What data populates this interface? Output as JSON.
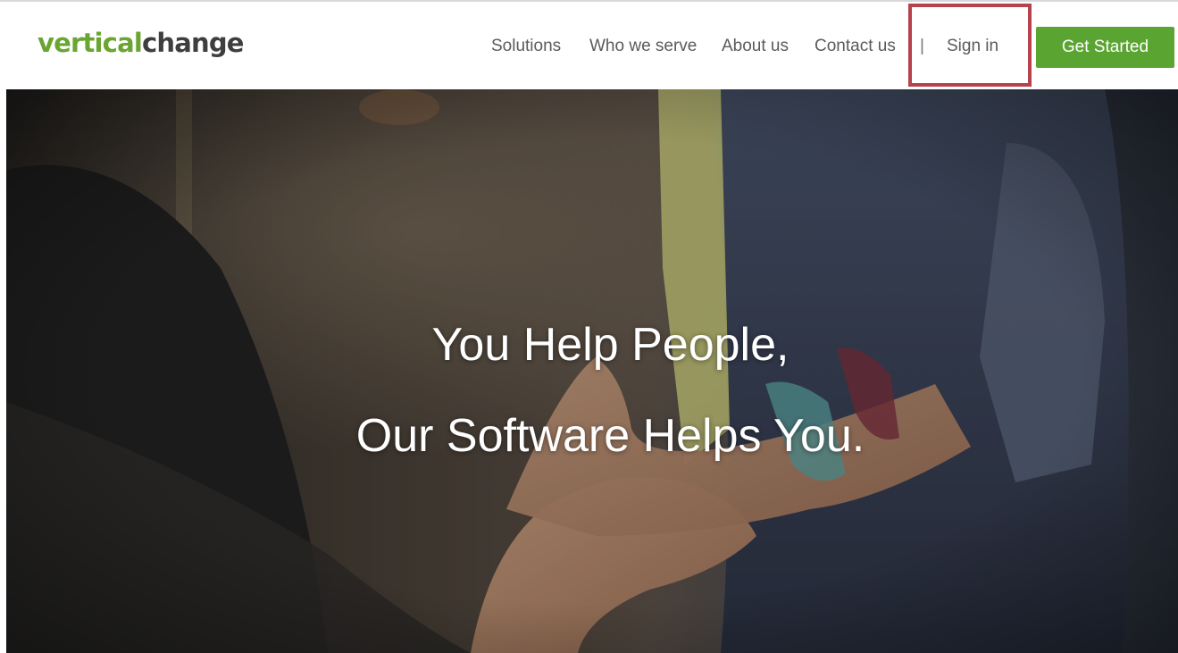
{
  "header": {
    "logo": {
      "part1": "vertical",
      "part2": "change"
    },
    "nav": [
      {
        "label": "Solutions"
      },
      {
        "label": "Who we serve"
      },
      {
        "label": "About us"
      },
      {
        "label": "Contact us"
      }
    ],
    "separator": "|",
    "sign_in_label": "Sign in",
    "cta_label": "Get Started"
  },
  "hero": {
    "line1": "You Help People,",
    "line2": "Our Software Helps You."
  },
  "colors": {
    "brand_green": "#6aa431",
    "cta_green": "#5aa532",
    "highlight_red": "#b5424c",
    "nav_text": "#5b5b5b"
  }
}
